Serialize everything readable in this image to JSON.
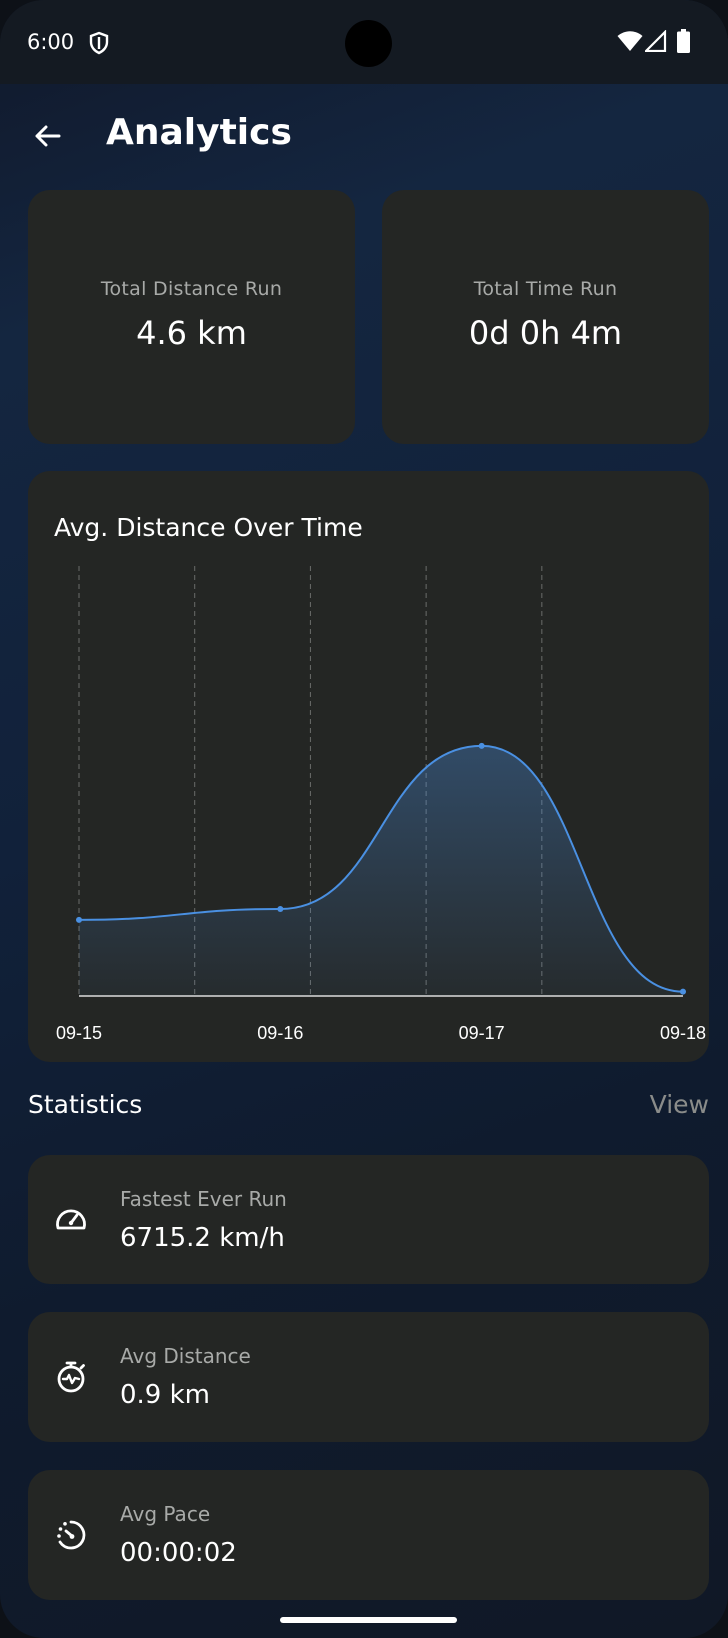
{
  "status_bar": {
    "time": "6:00"
  },
  "header": {
    "title": "Analytics",
    "back_icon": "arrow-left-icon"
  },
  "summary": {
    "distance": {
      "label": "Total Distance Run",
      "value": "4.6 km"
    },
    "time": {
      "label": "Total Time Run",
      "value": "0d 0h 4m"
    }
  },
  "chart": {
    "title": "Avg. Distance Over Time",
    "line_color": "#4a90e2"
  },
  "chart_data": {
    "type": "line",
    "title": "Avg. Distance Over Time",
    "x": [
      "09-15",
      "09-16",
      "09-17",
      "09-18"
    ],
    "series": [
      {
        "values": [
          0.35,
          0.4,
          1.15,
          0.02
        ]
      }
    ],
    "ylim": [
      0,
      2.0
    ],
    "smooth": true,
    "area_fill": true,
    "grid": "vertical-dashed"
  },
  "statistics": {
    "title": "Statistics",
    "view_label": "View",
    "items": [
      {
        "icon": "speedometer-icon",
        "label": "Fastest Ever Run",
        "value": "6715.2 km/h"
      },
      {
        "icon": "stopwatch-icon",
        "label": "Avg Distance",
        "value": "0.9 km"
      },
      {
        "icon": "timer-icon",
        "label": "Avg Pace",
        "value": "00:00:02"
      }
    ]
  },
  "colors": {
    "card": "#242624",
    "accent": "#4a90e2",
    "muted_text": "#a8aaa8"
  }
}
